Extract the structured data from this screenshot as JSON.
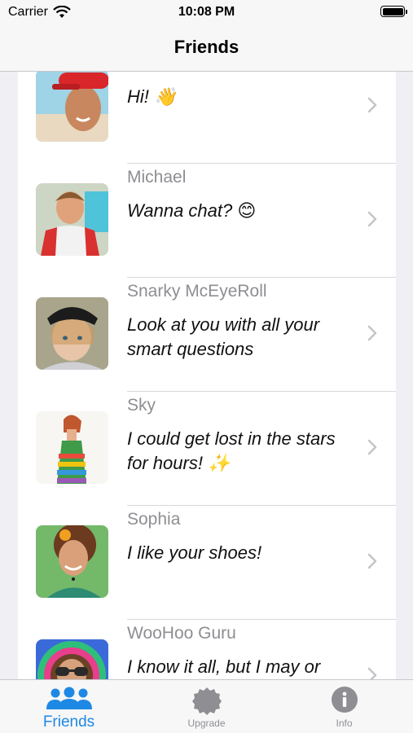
{
  "status": {
    "carrier": "Carrier",
    "time": "10:08 PM"
  },
  "nav": {
    "title": "Friends"
  },
  "friends": [
    {
      "name": "",
      "message": "Hi! 👋",
      "avatar": "girl-red-cap-avatar"
    },
    {
      "name": "Michael",
      "message": "Wanna chat? 😊",
      "avatar": "boy-red-shirt-avatar"
    },
    {
      "name": "Snarky McEyeRoll",
      "message": "Look at you with all your smart questions",
      "avatar": "girl-backwards-cap-avatar"
    },
    {
      "name": "Sky",
      "message": "I could get lost in the stars for hours! ✨",
      "avatar": "girl-rainbow-dress-avatar"
    },
    {
      "name": "Sophia",
      "message": "I like your shoes!",
      "avatar": "girl-curly-hair-avatar"
    },
    {
      "name": "WooHoo Guru",
      "message": "I know it all, but I may or",
      "avatar": "guru-sunglasses-avatar"
    }
  ],
  "tabs": [
    {
      "label": "Friends",
      "icon": "people-icon",
      "active": true
    },
    {
      "label": "Upgrade",
      "icon": "badge-icon",
      "active": false
    },
    {
      "label": "Info",
      "icon": "info-icon",
      "active": false
    }
  ],
  "colors": {
    "accent": "#1e88e5",
    "inactive": "#8e8e93"
  }
}
